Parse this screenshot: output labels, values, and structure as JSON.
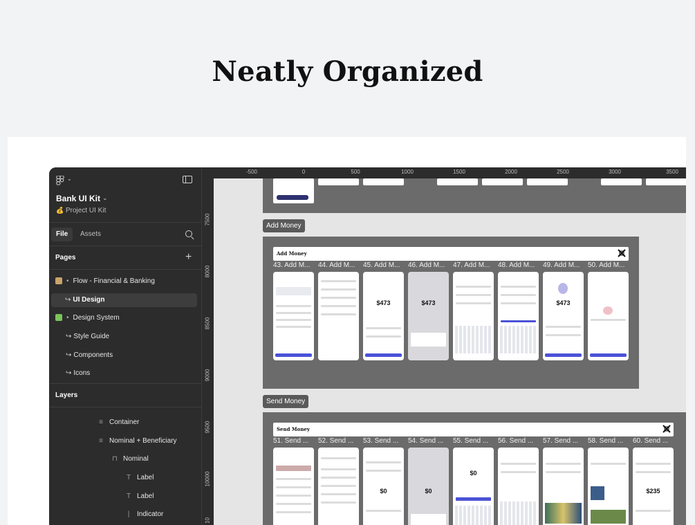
{
  "hero": {
    "title": "Neatly Organized"
  },
  "app": {
    "file_name": "Bank UI Kit",
    "project": "Project UI Kit",
    "tabs": [
      "File",
      "Assets"
    ],
    "pages_header": "Pages",
    "pages": [
      {
        "label": "Flow - Financial & Banking",
        "prefix": "•",
        "icon": "folder-emoji-icon"
      },
      {
        "label": "UI Design",
        "prefix": "↪",
        "selected": true
      },
      {
        "label": "Design System",
        "prefix": "•",
        "icon": "puzzle-emoji-icon"
      },
      {
        "label": "Style Guide",
        "prefix": "↪"
      },
      {
        "label": "Components",
        "prefix": "↪"
      },
      {
        "label": "Icons",
        "prefix": "↪"
      }
    ],
    "layers_header": "Layers",
    "layers": [
      {
        "label": "Container",
        "icon": "≡"
      },
      {
        "label": "Nominal + Beneficiary",
        "icon": "≡"
      },
      {
        "label": "Nominal",
        "icon": "⊓"
      },
      {
        "label": "Label",
        "icon": "T"
      },
      {
        "label": "Label",
        "icon": "T"
      },
      {
        "label": "Indicator",
        "icon": "|"
      }
    ]
  },
  "canvas": {
    "ruler_top": [
      "-500",
      "0",
      "500",
      "1000",
      "1500",
      "2000",
      "2500",
      "3000",
      "3500"
    ],
    "ruler_left": [
      "7500",
      "8000",
      "8500",
      "9000",
      "9500",
      "10000",
      "10"
    ],
    "add_money": {
      "section_label": "Add Money",
      "frame_title": "Add Money",
      "thumbs": [
        "43. Add M...",
        "44. Add M...",
        "45. Add M...",
        "46. Add M...",
        "47. Add M...",
        "48. Add M...",
        "49. Add M...",
        "50. Add M..."
      ],
      "amount": "$473"
    },
    "send_money": {
      "section_label": "Send Money",
      "frame_title": "Send Money",
      "thumbs": [
        "51. Send ...",
        "52. Send ...",
        "53. Send ...",
        "54. Send ...",
        "55. Send ...",
        "56. Send ...",
        "57. Send ...",
        "58. Send ...",
        "60. Send ..."
      ],
      "amounts": [
        "$0",
        "$0",
        "$0",
        "$235"
      ]
    }
  },
  "colors": {
    "accent": "#4b52d6",
    "sidebar_bg": "#2c2c2c",
    "canvas_bg": "#e5e5e5",
    "section_bg": "#6b6b6b"
  }
}
